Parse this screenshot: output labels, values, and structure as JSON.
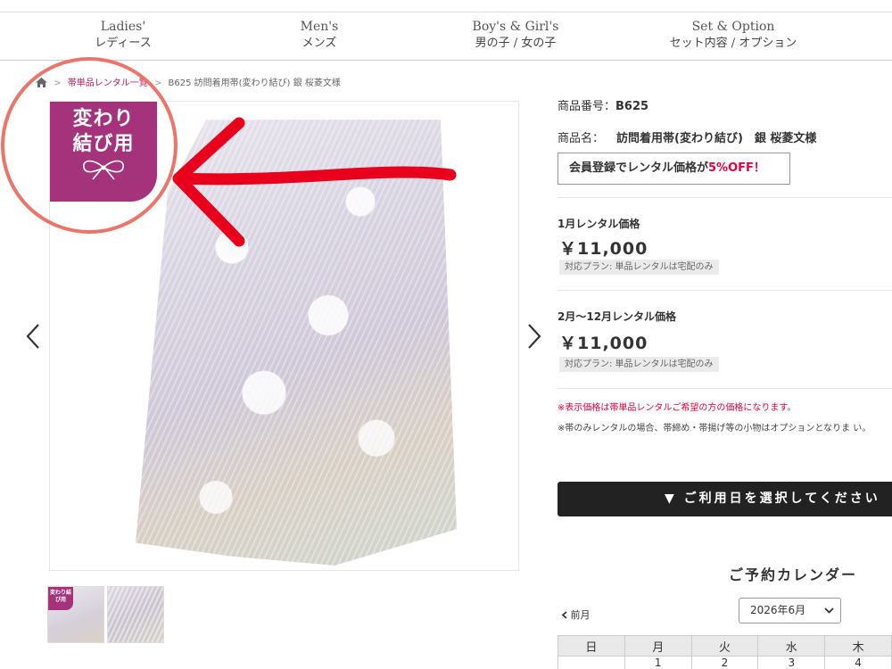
{
  "nav": [
    {
      "en": "Ladies'",
      "jp": "レディース"
    },
    {
      "en": "Men's",
      "jp": "メンズ"
    },
    {
      "en": "Boy's & Girl's",
      "jp": "男の子 / 女の子"
    },
    {
      "en": "Set & Option",
      "jp": "セット内容 / オプション"
    }
  ],
  "breadcrumb": {
    "link": "帯単品レンタル一覧",
    "current": "B625 訪問着用帯(変わり結び) 銀 桜菱文様",
    "sep": ">"
  },
  "gallery": {
    "badge_line1": "変わり",
    "badge_line2": "結び用",
    "thumb_badge": "変わり結び用",
    "badge_color": "#a4337c",
    "annotation_color": "#e8001c"
  },
  "product": {
    "code_label": "商品番号：",
    "code": "B625",
    "name_label": "商品名：",
    "name": "訪問着用帯(変わり結び)　銀 桜菱文様",
    "member_text": "会員登録でレンタル価格が",
    "member_off": "5%OFF！",
    "price1_title": "1月レンタル価格",
    "price1": "￥11,000",
    "price1_plan": "対応プラン: 単品レンタルは宅配のみ",
    "price2_title": "2月～12月レンタル価格",
    "price2": "￥11,000",
    "price2_plan": "対応プラン: 単品レンタルは宅配のみ",
    "note_red": "※表示価格は帯単品レンタルご希望の方の価格になります。",
    "note_gray": "※帯のみレンタルの場合、帯締め・帯揚げ等の小物はオプションとなりま い。",
    "select_date": "▼ ご利用日を選択してください"
  },
  "calendar": {
    "title": "ご予約カレンダー",
    "prev": "前月",
    "month": "2026年6月",
    "weekdays": [
      "日",
      "月",
      "火",
      "水",
      "木"
    ],
    "first_row": [
      "",
      "1",
      "2",
      "3",
      "4"
    ]
  },
  "colors": {
    "accent": "#c51d5f",
    "red": "#e8003d"
  }
}
